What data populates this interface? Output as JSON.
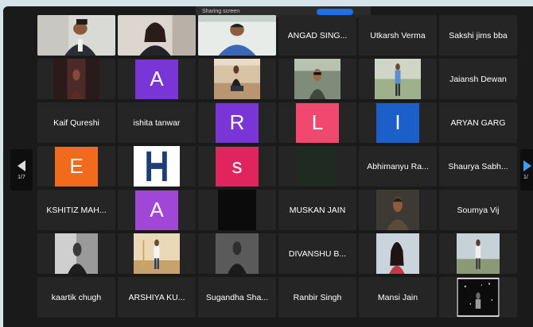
{
  "share_bar": {
    "label": "Sharing screen"
  },
  "pager": {
    "page_left": "1/7",
    "page_right": "1/"
  },
  "rows": [
    [
      {
        "type": "photo",
        "name": "participant-video",
        "scene": "boy"
      },
      {
        "type": "photo",
        "name": "participant-video",
        "scene": "woman"
      },
      {
        "type": "photo",
        "name": "participant-video",
        "scene": "man",
        "speaking": true
      },
      {
        "type": "name",
        "label": "ANGAD SING..."
      },
      {
        "type": "name",
        "label": "Utkarsh Verma"
      },
      {
        "type": "name",
        "label": "Sakshi jims bba"
      }
    ],
    [
      {
        "type": "photo",
        "name": "participant-video",
        "scene": "dark"
      },
      {
        "type": "avatar",
        "letter": "A",
        "color": "#7a35d6"
      },
      {
        "type": "photo",
        "name": "participant-video",
        "scene": "sitting"
      },
      {
        "type": "photo",
        "name": "participant-video",
        "scene": "car"
      },
      {
        "type": "photo",
        "name": "participant-video",
        "scene": "standing"
      },
      {
        "type": "name",
        "label": "Jaiansh Dewan"
      }
    ],
    [
      {
        "type": "name",
        "label": "Kaif Qureshi"
      },
      {
        "type": "name",
        "label": "ishita tanwar"
      },
      {
        "type": "avatar",
        "letter": "R",
        "color": "#7a35d6"
      },
      {
        "type": "avatar",
        "letter": "L",
        "color": "#f0486e"
      },
      {
        "type": "avatar",
        "letter": "I",
        "color": "#1c5fc8"
      },
      {
        "type": "name",
        "label": "ARYAN GARG"
      }
    ],
    [
      {
        "type": "avatar",
        "letter": "E",
        "color": "#f26b1d"
      },
      {
        "type": "photo",
        "name": "participant-video",
        "scene": "hlogo"
      },
      {
        "type": "avatar",
        "letter": "S",
        "color": "#e0245e",
        "lower": true
      },
      {
        "type": "photo",
        "name": "participant-video",
        "scene": "darkgreen"
      },
      {
        "type": "name",
        "label": "Abhimanyu Ra..."
      },
      {
        "type": "name",
        "label": "Shaurya Sabh..."
      }
    ],
    [
      {
        "type": "name",
        "label": "KSHITIZ MAH..."
      },
      {
        "type": "avatar",
        "letter": "A",
        "color": "#a147d8"
      },
      {
        "type": "photo",
        "name": "participant-video",
        "scene": "black"
      },
      {
        "type": "name",
        "label": "MUSKAN JAIN"
      },
      {
        "type": "photo",
        "name": "participant-video",
        "scene": "portrait"
      },
      {
        "type": "name",
        "label": "Soumya Vij"
      }
    ],
    [
      {
        "type": "photo",
        "name": "participant-video",
        "scene": "bw"
      },
      {
        "type": "photo",
        "name": "participant-video",
        "scene": "outdoor"
      },
      {
        "type": "photo",
        "name": "participant-video",
        "scene": "grey"
      },
      {
        "type": "name",
        "label": "DIVANSHU B..."
      },
      {
        "type": "photo",
        "name": "participant-video",
        "scene": "girl"
      },
      {
        "type": "photo",
        "name": "participant-video",
        "scene": "field"
      }
    ],
    [
      {
        "type": "name",
        "label": "kaartik chugh"
      },
      {
        "type": "name",
        "label": "ARSHIYA KU..."
      },
      {
        "type": "name",
        "label": "Sugandha Sha..."
      },
      {
        "type": "name",
        "label": "Ranbir Singh"
      },
      {
        "type": "name",
        "label": "Mansi Jain"
      },
      {
        "type": "photo",
        "name": "participant-video",
        "scene": "lights"
      }
    ]
  ]
}
